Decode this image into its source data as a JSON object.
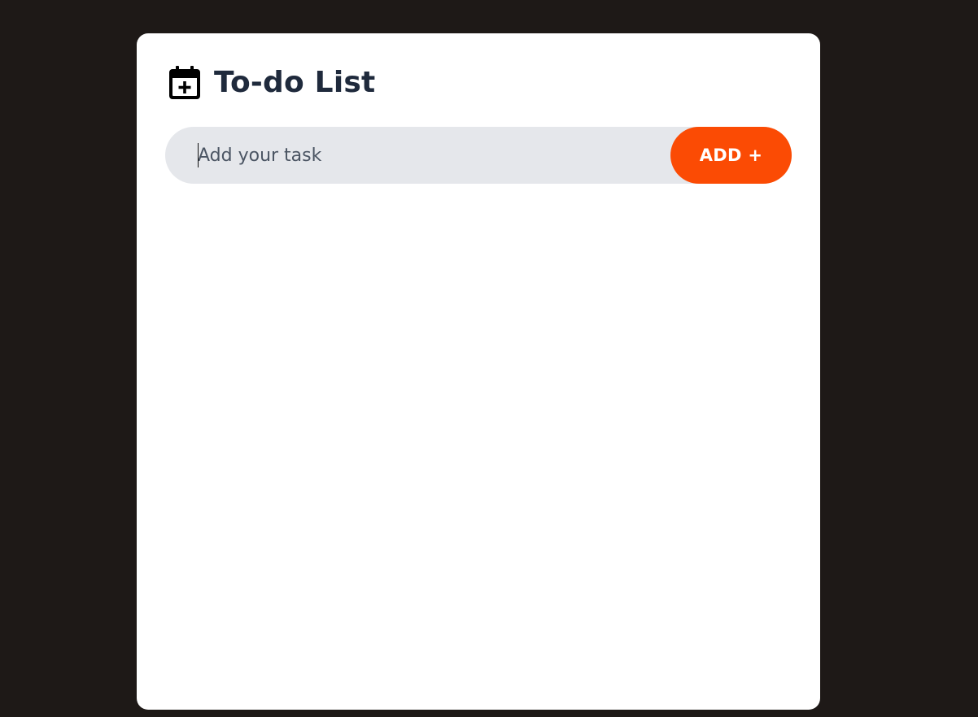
{
  "app": {
    "title": "To-do List",
    "icon": "calendar-plus-icon"
  },
  "input": {
    "placeholder": "Add your task",
    "value": ""
  },
  "add_button": {
    "label": "ADD +"
  },
  "colors": {
    "page_background": "#1e1917",
    "card_background": "#ffffff",
    "title_text": "#1f2a3c",
    "input_background": "#e5e7eb",
    "accent": "#fb4b04"
  },
  "tasks": []
}
